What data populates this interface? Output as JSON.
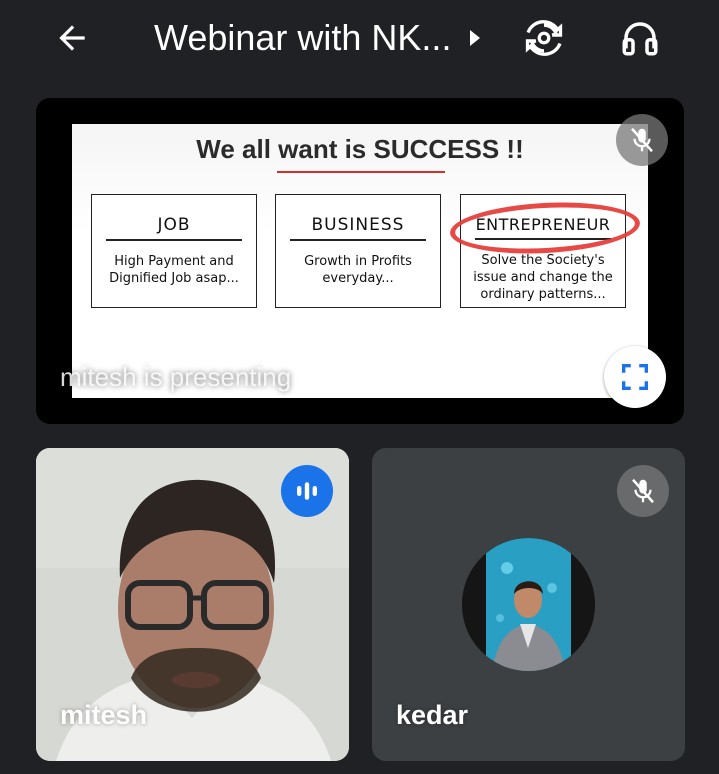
{
  "header": {
    "title": "Webinar with NK...",
    "back_icon": "arrow-back-icon",
    "caret_icon": "caret-right-icon",
    "switch_camera_icon": "switch-camera-icon",
    "audio_icon": "headphones-icon"
  },
  "presentation": {
    "presenter_label": "mitesh is presenting",
    "slide": {
      "title": "We all want is SUCCESS !!",
      "boxes": [
        {
          "heading": "JOB",
          "text": "High Payment and Dignified Job asap..."
        },
        {
          "heading": "BUSINESS",
          "text": "Growth in Profits everyday..."
        },
        {
          "heading": "ENTREPRENEUR",
          "text": "Solve the Society's issue and change the ordinary patterns..."
        }
      ]
    },
    "mute_icon": "mic-off-icon",
    "fullscreen_icon": "fullscreen-icon"
  },
  "participants": [
    {
      "name": "mitesh",
      "status_icon": "speaking-icon"
    },
    {
      "name": "kedar",
      "status_icon": "mic-off-icon"
    }
  ],
  "colors": {
    "background": "#202124",
    "tile": "#3c4043",
    "accent_blue": "#1a73e8",
    "highlight_red": "#e53935"
  }
}
